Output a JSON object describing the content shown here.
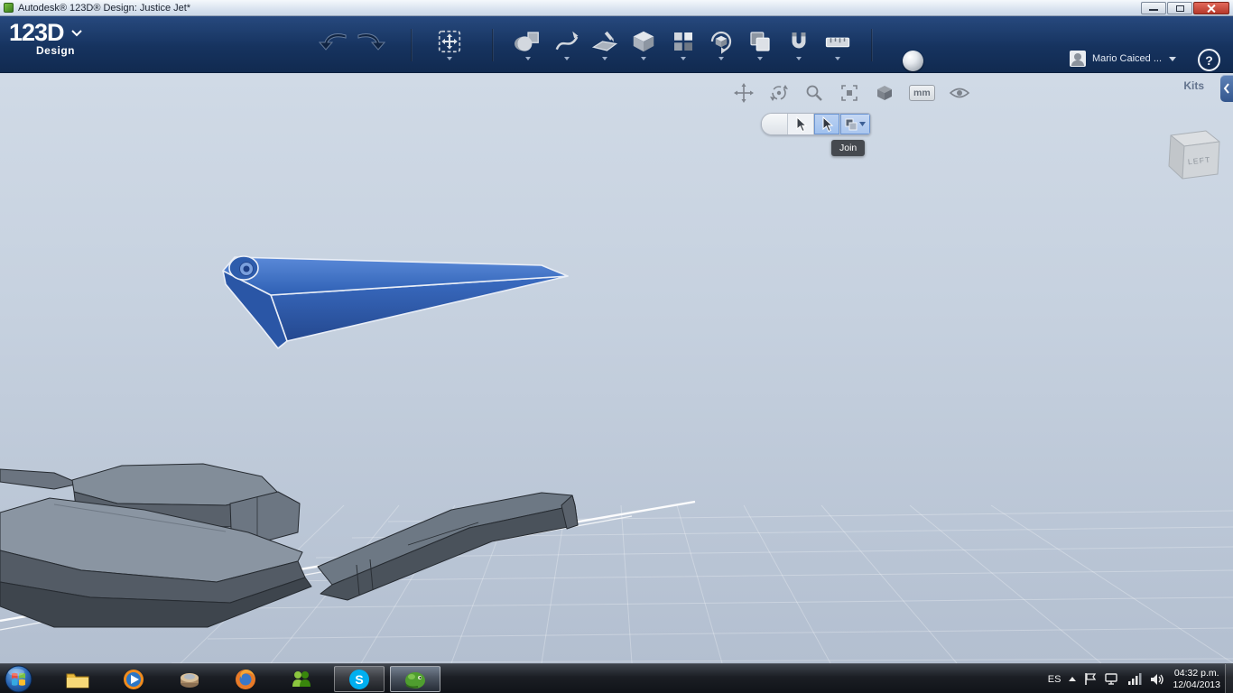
{
  "colors": {
    "header_bg": "#16335f",
    "selection_highlight": "#9ec0ee",
    "model_blue": "#3a6fc4",
    "model_gray": "#7a8591",
    "viewport_top": "#d0dae6",
    "viewport_bottom": "#b3bfd0",
    "taskbar_bg": "#1b1e24"
  },
  "window": {
    "title": "Autodesk® 123D® Design: Justice Jet*"
  },
  "header": {
    "logo_primary": "123D",
    "logo_secondary": "Design",
    "user_name": "Mario Caiced ...",
    "help_glyph": "?",
    "tool_icons": [
      "undo",
      "redo",
      "transform",
      "primitives",
      "sketch",
      "construct",
      "modify",
      "pattern",
      "grouping",
      "combine",
      "snap",
      "measure",
      "material-sphere"
    ]
  },
  "viewport": {
    "kits_label": "Kits",
    "units_label": "mm",
    "selection_tooltip": "Join",
    "viewcube_face": "LEFT",
    "nav_icons": [
      "pan",
      "orbit",
      "zoom",
      "zoom-window",
      "view-settings",
      "units-mm",
      "visibility-eye"
    ]
  },
  "taskbar": {
    "language": "ES",
    "time": "04:32 p.m.",
    "date": "12/04/2013",
    "app_icons": [
      "start",
      "explorer",
      "media-player",
      "round-app",
      "firefox",
      "messenger",
      "skype",
      "active-3d-app"
    ]
  }
}
